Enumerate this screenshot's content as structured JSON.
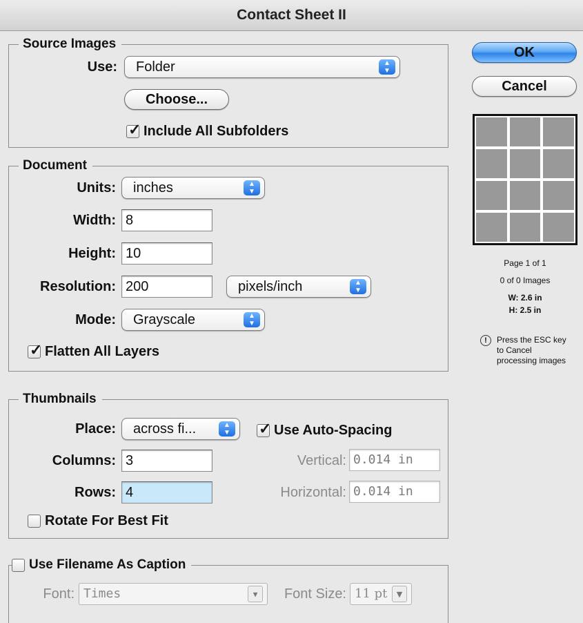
{
  "window": {
    "title": "Contact Sheet II"
  },
  "source_images": {
    "legend": "Source Images",
    "use_label": "Use:",
    "use_value": "Folder",
    "choose_label": "Choose...",
    "include_subfolders_label": "Include All Subfolders",
    "include_subfolders_checked": true
  },
  "document": {
    "legend": "Document",
    "units_label": "Units:",
    "units_value": "inches",
    "width_label": "Width:",
    "width_value": "8",
    "height_label": "Height:",
    "height_value": "10",
    "resolution_label": "Resolution:",
    "resolution_value": "200",
    "resolution_unit": "pixels/inch",
    "mode_label": "Mode:",
    "mode_value": "Grayscale",
    "flatten_label": "Flatten All Layers",
    "flatten_checked": true
  },
  "thumbnails": {
    "legend": "Thumbnails",
    "place_label": "Place:",
    "place_value": "across fi...",
    "auto_spacing_label": "Use Auto-Spacing",
    "auto_spacing_checked": true,
    "columns_label": "Columns:",
    "columns_value": "3",
    "rows_label": "Rows:",
    "rows_value": "4",
    "vertical_label": "Vertical:",
    "vertical_value": "0.014 in",
    "horizontal_label": "Horizontal:",
    "horizontal_value": "0.014 in",
    "rotate_label": "Rotate For Best Fit",
    "rotate_checked": false
  },
  "caption": {
    "legend": "Use Filename As Caption",
    "checked": false,
    "font_label": "Font:",
    "font_value": "Times",
    "font_size_label": "Font Size:",
    "font_size_value": "11 pt"
  },
  "buttons": {
    "ok": "OK",
    "cancel": "Cancel"
  },
  "preview": {
    "page": "Page 1 of 1",
    "images": "0 of 0 Images",
    "width": "W: 2.6 in",
    "height": "H: 2.5 in",
    "esc_note": "Press the ESC key to Cancel processing images",
    "grid_columns": 3,
    "grid_rows": 4
  },
  "icons": {
    "check": "checkmark-icon",
    "popup_arrows": "updown-arrows-icon",
    "warning": "exclamation-icon"
  }
}
